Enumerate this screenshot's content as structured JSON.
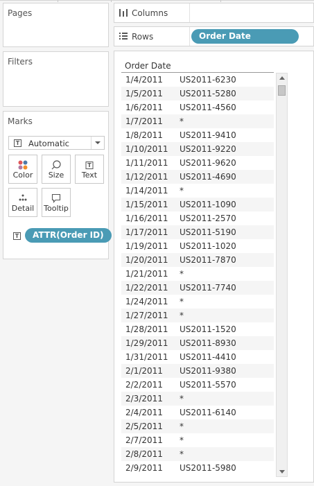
{
  "cards": {
    "pages": "Pages",
    "filters": "Filters",
    "marks": "Marks"
  },
  "marks": {
    "type_label": "Automatic",
    "buttons": {
      "color": "Color",
      "size": "Size",
      "text": "Text",
      "detail": "Detail",
      "tooltip": "Tooltip"
    },
    "text_pill": "ATTR(Order ID)"
  },
  "shelves": {
    "columns_label": "Columns",
    "rows_label": "Rows",
    "rows_pill": "Order Date"
  },
  "table": {
    "header": "Order Date",
    "rows": [
      {
        "date": "1/4/2011",
        "id": "US2011-6230"
      },
      {
        "date": "1/5/2011",
        "id": "US2011-5280"
      },
      {
        "date": "1/6/2011",
        "id": "US2011-4560"
      },
      {
        "date": "1/7/2011",
        "id": "*"
      },
      {
        "date": "1/8/2011",
        "id": "US2011-9410"
      },
      {
        "date": "1/10/2011",
        "id": "US2011-9220"
      },
      {
        "date": "1/11/2011",
        "id": "US2011-9620"
      },
      {
        "date": "1/12/2011",
        "id": "US2011-4690"
      },
      {
        "date": "1/14/2011",
        "id": "*"
      },
      {
        "date": "1/15/2011",
        "id": "US2011-1090"
      },
      {
        "date": "1/16/2011",
        "id": "US2011-2570"
      },
      {
        "date": "1/17/2011",
        "id": "US2011-5190"
      },
      {
        "date": "1/19/2011",
        "id": "US2011-1020"
      },
      {
        "date": "1/20/2011",
        "id": "US2011-7870"
      },
      {
        "date": "1/21/2011",
        "id": "*"
      },
      {
        "date": "1/22/2011",
        "id": "US2011-7740"
      },
      {
        "date": "1/24/2011",
        "id": "*"
      },
      {
        "date": "1/27/2011",
        "id": "*"
      },
      {
        "date": "1/28/2011",
        "id": "US2011-1520"
      },
      {
        "date": "1/29/2011",
        "id": "US2011-8930"
      },
      {
        "date": "1/31/2011",
        "id": "US2011-4410"
      },
      {
        "date": "2/1/2011",
        "id": "US2011-9380"
      },
      {
        "date": "2/2/2011",
        "id": "US2011-5570"
      },
      {
        "date": "2/3/2011",
        "id": "*"
      },
      {
        "date": "2/4/2011",
        "id": "US2011-6140"
      },
      {
        "date": "2/5/2011",
        "id": "*"
      },
      {
        "date": "2/7/2011",
        "id": "*"
      },
      {
        "date": "2/8/2011",
        "id": "*"
      },
      {
        "date": "2/9/2011",
        "id": "US2011-5980"
      }
    ]
  },
  "colors": {
    "pill": "#4a9bb5",
    "alt_row": "#f5f5f5",
    "panel_bg": "#f5f5f5"
  },
  "icons": {
    "columns": "columns-icon",
    "rows": "rows-icon",
    "mark_type": "text-mark-icon",
    "color": "color-dots-icon",
    "size": "size-lasso-icon",
    "text": "text-icon",
    "detail": "detail-dots-icon",
    "tooltip": "tooltip-bubble-icon"
  }
}
